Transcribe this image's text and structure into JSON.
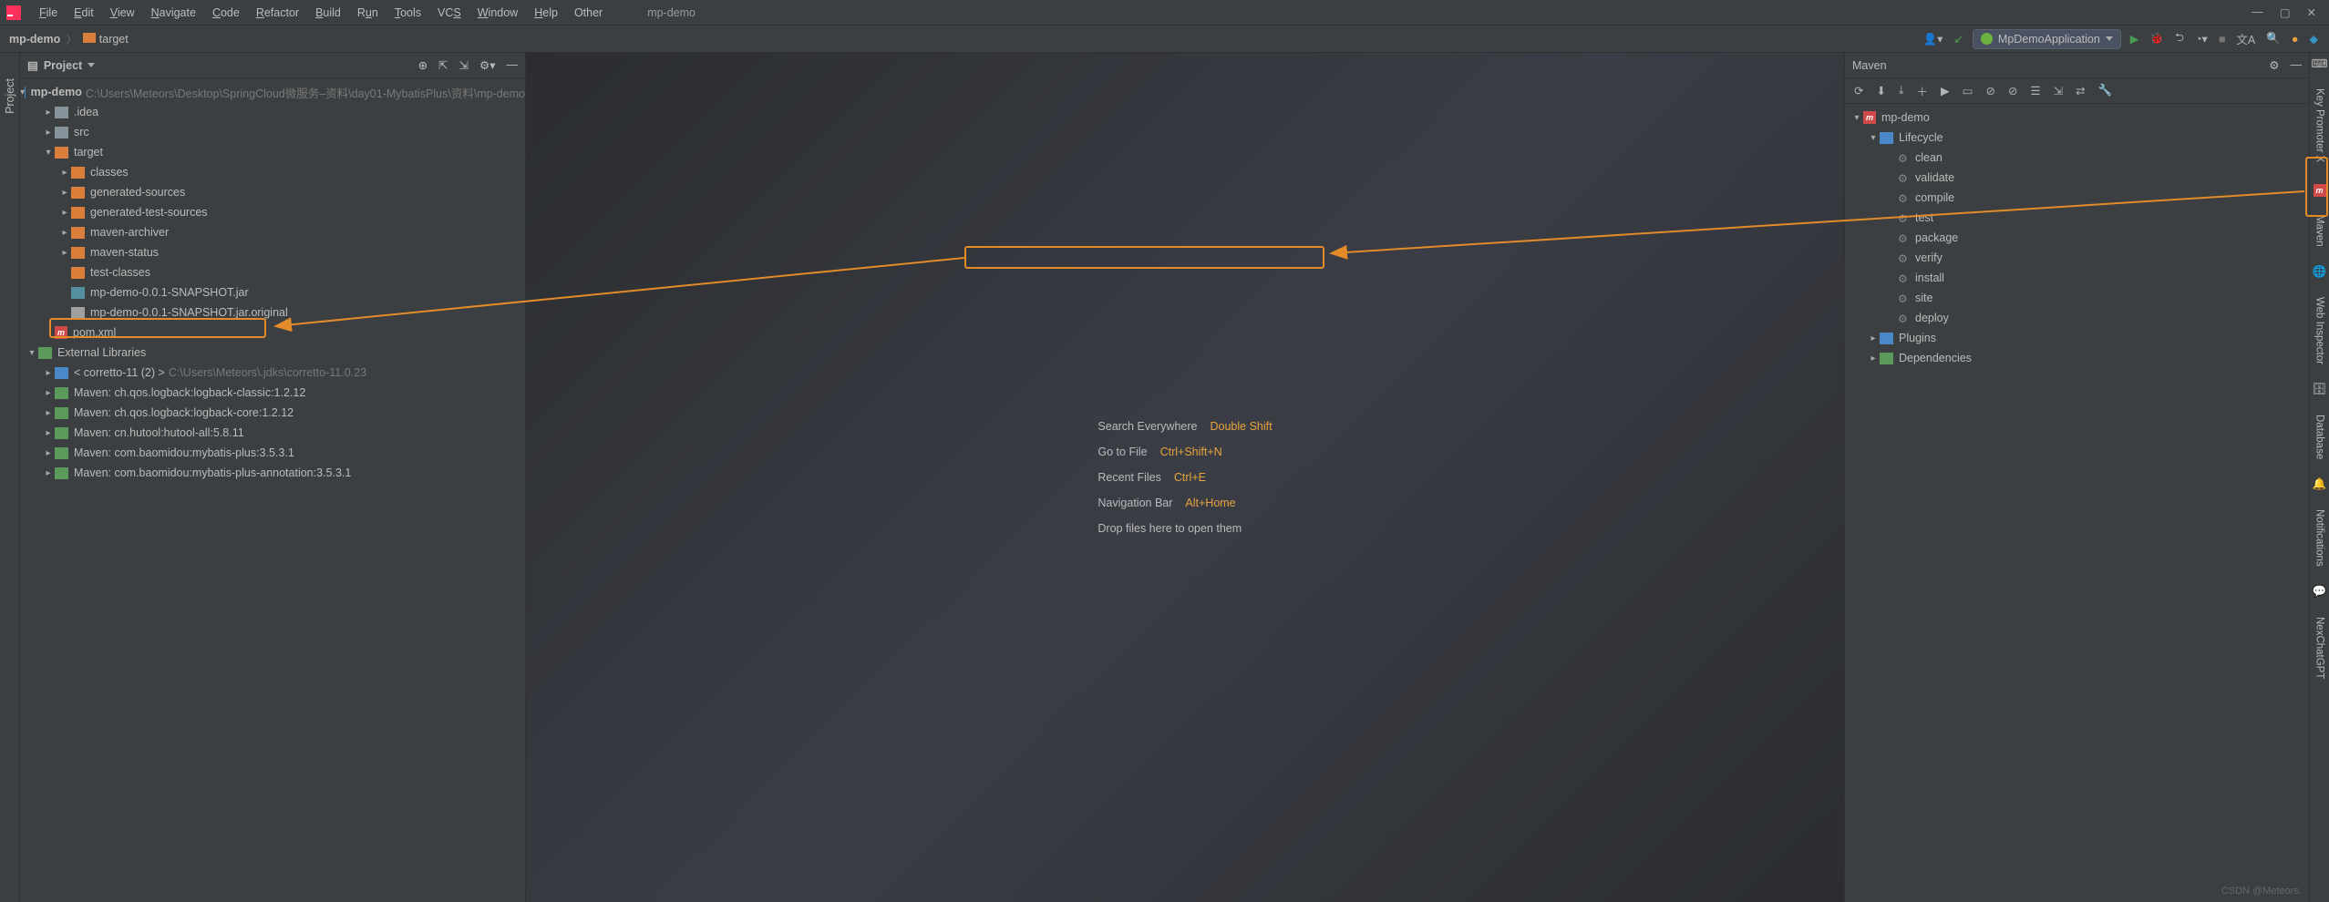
{
  "menu": {
    "items": [
      "File",
      "Edit",
      "View",
      "Navigate",
      "Code",
      "Refactor",
      "Build",
      "Run",
      "Tools",
      "VCS",
      "Window",
      "Help",
      "Other"
    ],
    "project": "mp-demo"
  },
  "breadcrumb": {
    "root": "mp-demo",
    "target": "target"
  },
  "run_config": {
    "name": "MpDemoApplication"
  },
  "project_panel": {
    "title": "Project"
  },
  "tree": {
    "root": {
      "name": "mp-demo",
      "path": "C:\\Users\\Meteors\\Desktop\\SpringCloud微服务–资料\\day01-MybatisPlus\\资料\\mp-demo"
    },
    "idea": ".idea",
    "src": "src",
    "target": "target",
    "classes": "classes",
    "gensrc": "generated-sources",
    "gentest": "generated-test-sources",
    "archiver": "maven-archiver",
    "status": "maven-status",
    "testclasses": "test-classes",
    "jar": "mp-demo-0.0.1-SNAPSHOT.jar",
    "jarorig": "mp-demo-0.0.1-SNAPSHOT.jar.original",
    "pom": "pom.xml",
    "extlib": "External Libraries",
    "corretto": "< corretto-11 (2) >",
    "corretto_path": "C:\\Users\\Meteors\\.jdks\\corretto-11.0.23",
    "lib1": "Maven: ch.qos.logback:logback-classic:1.2.12",
    "lib2": "Maven: ch.qos.logback:logback-core:1.2.12",
    "lib3": "Maven: cn.hutool:hutool-all:5.8.11",
    "lib4": "Maven: com.baomidou:mybatis-plus:3.5.3.1",
    "lib5": "Maven: com.baomidou:mybatis-plus-annotation:3.5.3.1"
  },
  "welcome": {
    "l1": "Search Everywhere",
    "k1": "Double Shift",
    "l2": "Go to File",
    "k2": "Ctrl+Shift+N",
    "l3": "Recent Files",
    "k3": "Ctrl+E",
    "l4": "Navigation Bar",
    "k4": "Alt+Home",
    "l5": "Drop files here to open them"
  },
  "maven": {
    "title": "Maven",
    "root": "mp-demo",
    "lifecycle": "Lifecycle",
    "goals": [
      "clean",
      "validate",
      "compile",
      "test",
      "package",
      "verify",
      "install",
      "site",
      "deploy"
    ],
    "plugins": "Plugins",
    "deps": "Dependencies"
  },
  "right_tabs": [
    "Key Promoter X",
    "Maven",
    "Web Inspector",
    "Database",
    "Notifications",
    "NexChatGPT"
  ],
  "left_tab": "Project",
  "watermark": "CSDN @Meteors."
}
